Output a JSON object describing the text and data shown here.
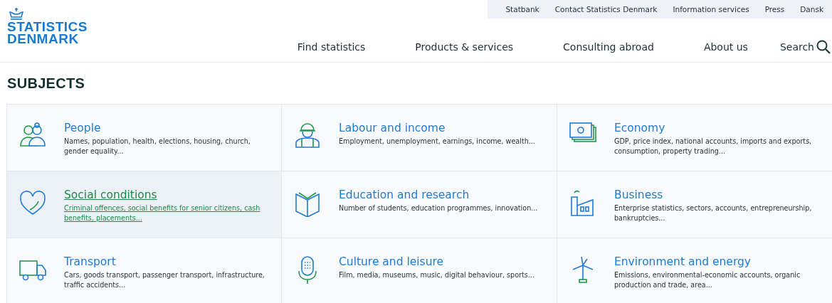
{
  "logo": {
    "line_1": "STATISTICS",
    "line_2": "DENMARK"
  },
  "utility_links": [
    "Statbank",
    "Contact Statistics Denmark",
    "Information services",
    "Press",
    "Dansk"
  ],
  "main_nav": [
    "Find statistics",
    "Products & services",
    "Consulting abroad",
    "About us"
  ],
  "search": {
    "label": "Search"
  },
  "heading": "SUBJECTS",
  "subjects": [
    {
      "title": "People",
      "description": "Names, population, health, elections, housing, church, gender equality...",
      "highlighted": false
    },
    {
      "title": "Labour and income",
      "description": "Employment, unemployment, earnings, income, wealth...",
      "highlighted": false
    },
    {
      "title": "Economy",
      "description": "GDP, price index, national accounts, imports and exports, consumption, property trading...",
      "highlighted": false
    },
    {
      "title": "Social conditions",
      "description": "Criminal offences, social benefits for senior citizens, cash benefits, placements...",
      "highlighted": true
    },
    {
      "title": "Education and research",
      "description": "Number of students, education programmes, innovation...",
      "highlighted": false
    },
    {
      "title": "Business",
      "description": "Enterprise statistics, sectors, accounts, entrepreneurship, bankruptcies...",
      "highlighted": false
    },
    {
      "title": "Transport",
      "description": "Cars, goods transport, passenger transport, infrastructure, traffic accidents...",
      "highlighted": false
    },
    {
      "title": "Culture and leisure",
      "description": "Film, media, museums, music, digital behaviour, sports...",
      "highlighted": false
    },
    {
      "title": "Environment and energy",
      "description": "Emissions, environmental-economic accounts, organic production and trade, area...",
      "highlighted": false
    }
  ]
}
